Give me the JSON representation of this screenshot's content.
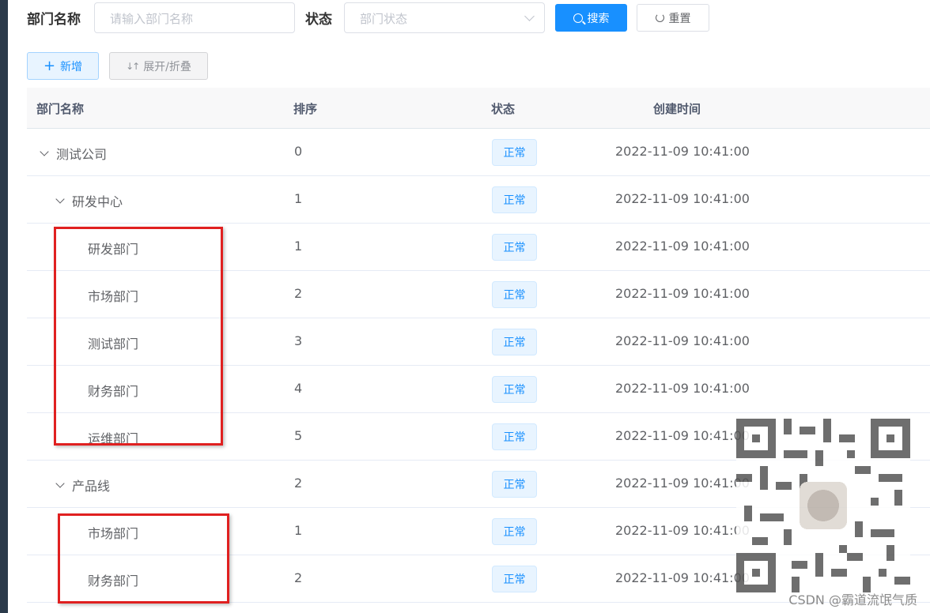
{
  "search_form": {
    "dept_name_label": "部门名称",
    "dept_name_placeholder": "请输入部门名称",
    "status_label": "状态",
    "status_placeholder": "部门状态",
    "search_button": "搜索",
    "reset_button": "重置"
  },
  "toolbar": {
    "add_button": "新增",
    "toggle_button": "展开/折叠"
  },
  "table": {
    "headers": [
      "部门名称",
      "排序",
      "状态",
      "创建时间"
    ],
    "rows": [
      {
        "name": "测试公司",
        "level": 0,
        "expandable": true,
        "order": "0",
        "status": "正常",
        "created": "2022-11-09 10:41:00"
      },
      {
        "name": "研发中心",
        "level": 1,
        "expandable": true,
        "order": "1",
        "status": "正常",
        "created": "2022-11-09 10:41:00"
      },
      {
        "name": "研发部门",
        "level": 2,
        "expandable": false,
        "order": "1",
        "status": "正常",
        "created": "2022-11-09 10:41:00"
      },
      {
        "name": "市场部门",
        "level": 2,
        "expandable": false,
        "order": "2",
        "status": "正常",
        "created": "2022-11-09 10:41:00"
      },
      {
        "name": "测试部门",
        "level": 2,
        "expandable": false,
        "order": "3",
        "status": "正常",
        "created": "2022-11-09 10:41:00"
      },
      {
        "name": "财务部门",
        "level": 2,
        "expandable": false,
        "order": "4",
        "status": "正常",
        "created": "2022-11-09 10:41:00"
      },
      {
        "name": "运维部门",
        "level": 2,
        "expandable": false,
        "order": "5",
        "status": "正常",
        "created": "2022-11-09 10:41:00"
      },
      {
        "name": "产品线",
        "level": 1,
        "expandable": true,
        "order": "2",
        "status": "正常",
        "created": "2022-11-09 10:41:00"
      },
      {
        "name": "市场部门",
        "level": 2,
        "expandable": false,
        "order": "1",
        "status": "正常",
        "created": "2022-11-09 10:41:00"
      },
      {
        "name": "财务部门",
        "level": 2,
        "expandable": false,
        "order": "2",
        "status": "正常",
        "created": "2022-11-09 10:41:00"
      }
    ]
  },
  "watermark": "CSDN @霸道流氓气质",
  "colors": {
    "primary": "#1890ff",
    "annotation": "#e02020"
  }
}
